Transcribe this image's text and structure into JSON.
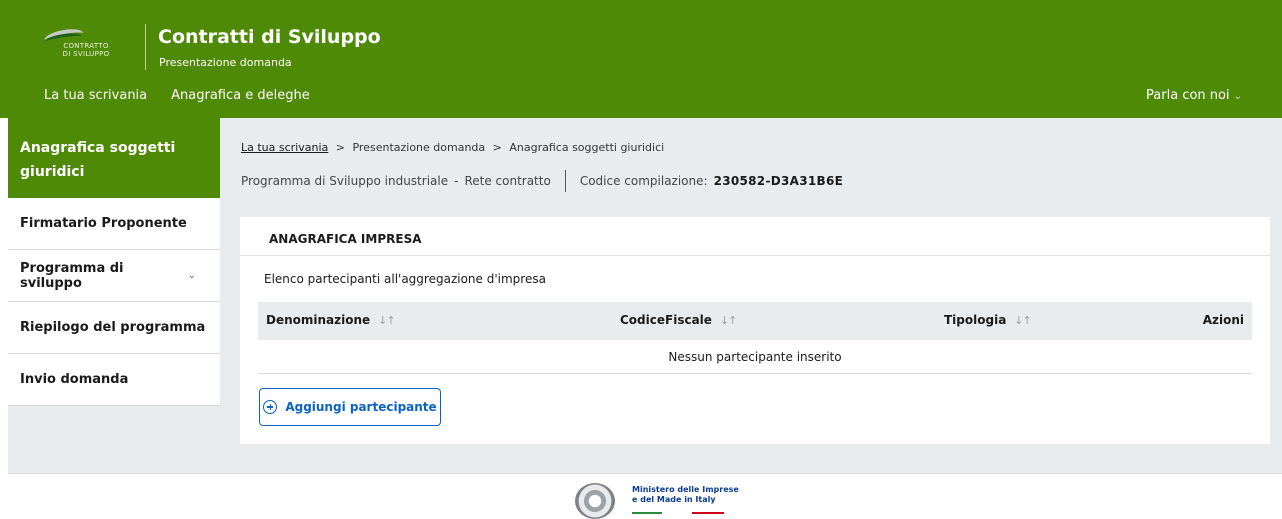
{
  "header": {
    "logo_text_line1": "CONTRATTO",
    "logo_text_line2": "DI SVILUPPO",
    "title": "Contratti di Sviluppo",
    "subtitle": "Presentazione domanda",
    "nav": [
      "La tua scrivania",
      "Anagrafica e deleghe"
    ],
    "talk_label": "Parla con noi"
  },
  "sidebar": {
    "active_label": "Anagrafica soggetti giuridici",
    "items": [
      {
        "label": "Firmatario Proponente",
        "has_submenu": false
      },
      {
        "label": "Programma di sviluppo",
        "has_submenu": true
      },
      {
        "label": "Riepilogo del programma",
        "has_submenu": false
      },
      {
        "label": "Invio domanda",
        "has_submenu": false
      }
    ]
  },
  "breadcrumb": {
    "items": [
      "La tua scrivania",
      "Presentazione domanda",
      "Anagrafica soggetti giuridici"
    ]
  },
  "program": {
    "name": "Programma di Sviluppo industriale",
    "type": "Rete contratto",
    "code_label": "Codice compilazione:",
    "code_value": "230582-D3A31B6E"
  },
  "card": {
    "title": "ANAGRAFICA IMPRESA",
    "list_title": "Elenco partecipanti all'aggregazione d'impresa",
    "columns": [
      "Denominazione",
      "CodiceFiscale",
      "Tipologia",
      "Azioni"
    ],
    "empty_text": "Nessun partecipante inserito",
    "add_button": "Aggiungi partecipante"
  },
  "footer": {
    "ministry_line1": "Ministero delle Imprese",
    "ministry_line2": "e del Made in Italy"
  },
  "colors": {
    "brand_green": "#4e8a06",
    "primary_blue": "#0b63c5",
    "background_grey": "#e9ecee"
  }
}
